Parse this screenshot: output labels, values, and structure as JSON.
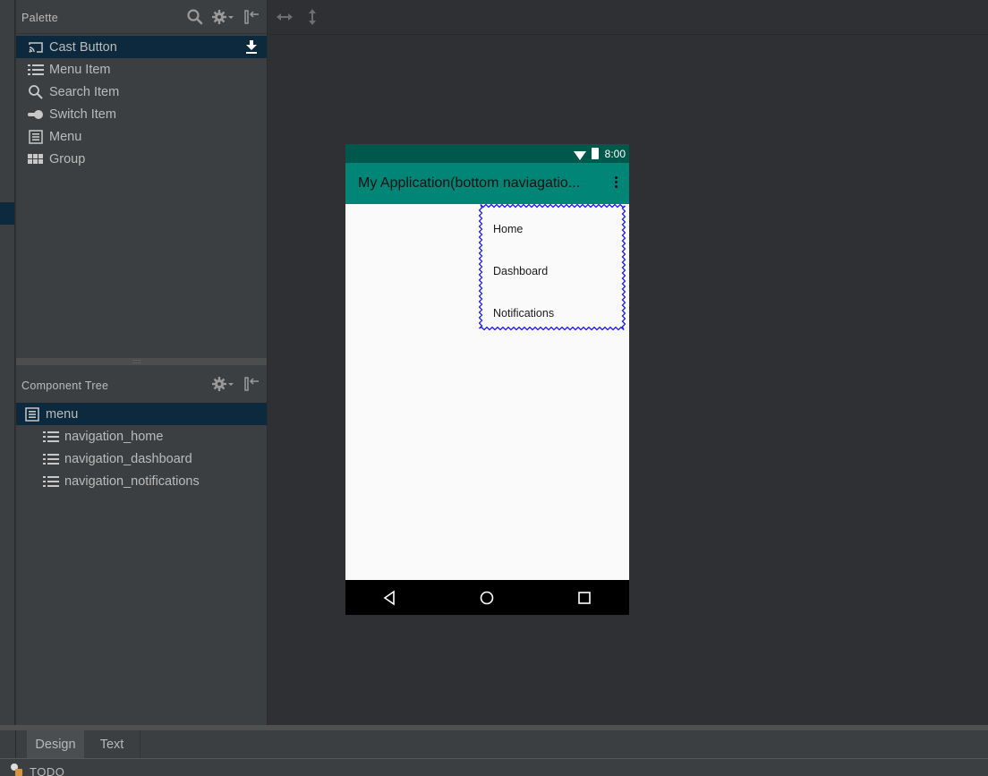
{
  "palette": {
    "title": "Palette",
    "header_icons": [
      "search-icon",
      "gear-icon",
      "collapse-panel-icon"
    ],
    "items": [
      {
        "label": "Cast Button",
        "icon": "cast-icon",
        "selected": true,
        "action_icon": "download-icon"
      },
      {
        "label": "Menu Item",
        "icon": "list-icon"
      },
      {
        "label": "Search Item",
        "icon": "search-icon"
      },
      {
        "label": "Switch Item",
        "icon": "switch-icon"
      },
      {
        "label": "Menu",
        "icon": "menu-icon"
      },
      {
        "label": "Group",
        "icon": "grid-icon"
      }
    ]
  },
  "canvas_toolbar": {
    "icons": [
      "resize-horizontal-icon",
      "resize-vertical-icon"
    ]
  },
  "component_tree": {
    "title": "Component Tree",
    "header_icons": [
      "gear-icon",
      "collapse-panel-icon"
    ],
    "root": {
      "label": "menu",
      "icon": "menu-icon",
      "selected": true
    },
    "children": [
      {
        "label": "navigation_home",
        "icon": "list-icon"
      },
      {
        "label": "navigation_dashboard",
        "icon": "list-icon"
      },
      {
        "label": "navigation_notifications",
        "icon": "list-icon"
      }
    ]
  },
  "phone": {
    "status_bar": {
      "time": "8:00",
      "color": "#00574b"
    },
    "app_bar": {
      "title": "My Application(bottom naviagatio...",
      "color": "#008577"
    },
    "popup_menu": {
      "items": [
        "Home",
        "Dashboard",
        "Notifications"
      ],
      "selection_color": "#1a1aff"
    },
    "nav_bar": [
      "back-icon",
      "home-icon",
      "recents-icon"
    ]
  },
  "editor_tabs": {
    "tabs": [
      {
        "label": "Design",
        "active": true
      },
      {
        "label": "Text",
        "active": false
      }
    ]
  },
  "status_strip": {
    "todo_label": "TODO"
  }
}
